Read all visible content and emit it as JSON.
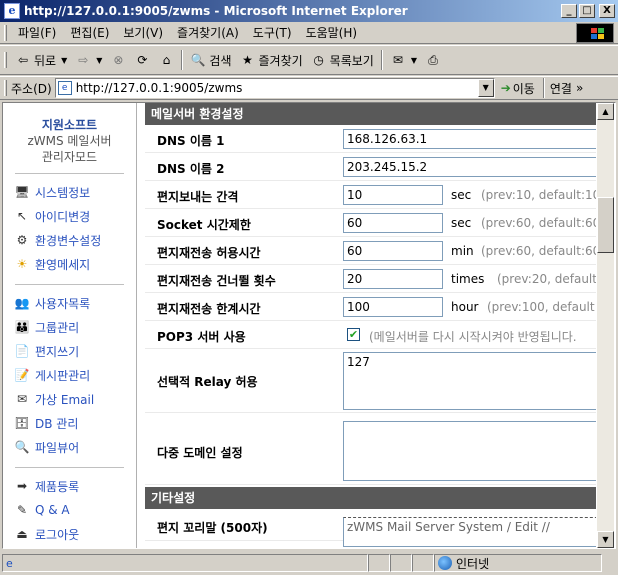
{
  "window": {
    "title": "http://127.0.0.1:9005/zwms - Microsoft Internet Explorer",
    "icon": "ie-icon",
    "min_label": "_",
    "max_label": "□",
    "close_label": "X"
  },
  "menubar": {
    "items": [
      "파일(F)",
      "편집(E)",
      "보기(V)",
      "즐겨찾기(A)",
      "도구(T)",
      "도움말(H)"
    ]
  },
  "toolbar": {
    "back_label": "뒤로",
    "search_label": "검색",
    "favorites_label": "즐겨찾기",
    "history_label": "목록보기"
  },
  "addressbar": {
    "label": "주소(D)",
    "url": "http://127.0.0.1:9005/zwms",
    "go_label": "이동",
    "links_label": "연결",
    "more": "»"
  },
  "sidebar": {
    "org": "지원소프트",
    "product": "zWMS 메일서버",
    "mode": "관리자모드",
    "group1": [
      {
        "label": "시스템정보",
        "icon": "monitor-icon",
        "glyph": "🖥"
      },
      {
        "label": "아이디변경",
        "icon": "cursor-icon",
        "glyph": "↖"
      },
      {
        "label": "환경변수설정",
        "icon": "settings-icon",
        "glyph": "⚙"
      },
      {
        "label": "환영메세지",
        "icon": "sun-icon",
        "glyph": "☀"
      }
    ],
    "group2": [
      {
        "label": "사용자목록",
        "icon": "users-icon",
        "glyph": "👥"
      },
      {
        "label": "그룹관리",
        "icon": "group-icon",
        "glyph": "👪"
      },
      {
        "label": "편지쓰기",
        "icon": "document-icon",
        "glyph": "📄"
      },
      {
        "label": "게시판관리",
        "icon": "notebook-icon",
        "glyph": "📝"
      },
      {
        "label": "가상 Email",
        "icon": "mail-icon",
        "glyph": "✉"
      },
      {
        "label": "DB 관리",
        "icon": "database-icon",
        "glyph": "🗄"
      },
      {
        "label": "파일뷰어",
        "icon": "file-viewer-icon",
        "glyph": "🔍"
      }
    ],
    "group3": [
      {
        "label": "제품등록",
        "icon": "register-icon",
        "glyph": "➡"
      },
      {
        "label": "Q & A",
        "icon": "qa-icon",
        "glyph": "✎"
      },
      {
        "label": "로그아웃",
        "icon": "logout-icon",
        "glyph": "⏏"
      }
    ]
  },
  "main": {
    "section1_title": "메일서버 환경설정",
    "dns1": {
      "label": "DNS 이름 1",
      "value": "168.126.63.1"
    },
    "dns2": {
      "label": "DNS 이름 2",
      "value": "203.245.15.2"
    },
    "send_interval": {
      "label": "편지보내는 간격",
      "value": "10",
      "unit": "sec",
      "hint": "(prev:10, default:10)"
    },
    "socket_timeout": {
      "label": "Socket 시간제한",
      "value": "60",
      "unit": "sec",
      "hint": "(prev:60, default:60)"
    },
    "resend_allow": {
      "label": "편지재전송 허용시간",
      "value": "60",
      "unit": "min",
      "hint": "(prev:60, default:60)"
    },
    "resend_skip": {
      "label": "편지재전송 건너뛸 횟수",
      "value": "20",
      "unit": "times",
      "hint": "(prev:20, default:20)"
    },
    "resend_limit": {
      "label": "편지재전송 한계시간",
      "value": "100",
      "unit": "hour",
      "hint": "(prev:100, default:10"
    },
    "pop3": {
      "label": "POP3 서버 사용",
      "checked": true,
      "note": "(메일서버를 다시 시작시켜야 반영됩니다."
    },
    "relay": {
      "label": "선택적 Relay 허용",
      "value": "127"
    },
    "multi_domain": {
      "label": "다중 도메인 설정",
      "value": ""
    },
    "section2_title": "기타설정",
    "signature": {
      "label": "편지 꼬리말 (500자)",
      "value": "zWMS Mail Server System / Edit //"
    }
  },
  "statusbar": {
    "zone_label": "인터넷"
  }
}
